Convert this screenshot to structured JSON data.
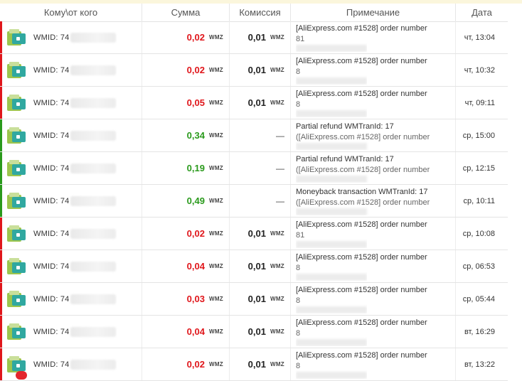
{
  "header": {
    "col_counterparty": "Кому\\от кого",
    "col_amount": "Сумма",
    "col_fee": "Комиссия",
    "col_note": "Примечание",
    "col_date": "Дата"
  },
  "colors": {
    "negative": "#e0161b",
    "positive": "#2a9a1c"
  },
  "rows": [
    {
      "wmid": "WMID: 74",
      "amount": "0,02",
      "type": "out",
      "currency": "WMZ",
      "fee": "0,01",
      "fee_currency": "WMZ",
      "note_line1": "[AliExpress.com #1528] order number",
      "note_line2": "81",
      "date": "чт, 13:04"
    },
    {
      "wmid": "WMID: 74",
      "amount": "0,02",
      "type": "out",
      "currency": "WMZ",
      "fee": "0,01",
      "fee_currency": "WMZ",
      "note_line1": "[AliExpress.com #1528] order number",
      "note_line2": "8",
      "date": "чт, 10:32"
    },
    {
      "wmid": "WMID: 74",
      "amount": "0,05",
      "type": "out",
      "currency": "WMZ",
      "fee": "0,01",
      "fee_currency": "WMZ",
      "note_line1": "[AliExpress.com #1528] order number",
      "note_line2": "8",
      "date": "чт, 09:11"
    },
    {
      "wmid": "WMID: 74",
      "amount": "0,34",
      "type": "in",
      "currency": "WMZ",
      "fee": "—",
      "fee_currency": "",
      "note_line1": "Partial refund WMTranId: 17",
      "note_line2": "([AliExpress.com #1528] order number",
      "date": "ср, 15:00"
    },
    {
      "wmid": "WMID: 74",
      "amount": "0,19",
      "type": "in",
      "currency": "WMZ",
      "fee": "—",
      "fee_currency": "",
      "note_line1": "Partial refund WMTranId: 17",
      "note_line2": "([AliExpress.com #1528] order number",
      "date": "ср, 12:15"
    },
    {
      "wmid": "WMID: 74",
      "amount": "0,49",
      "type": "in",
      "currency": "WMZ",
      "fee": "—",
      "fee_currency": "",
      "note_line1": "Moneyback transaction WMTranId: 17",
      "note_line2": "([AliExpress.com #1528] order number",
      "date": "ср, 10:11"
    },
    {
      "wmid": "WMID: 74",
      "amount": "0,02",
      "type": "out",
      "currency": "WMZ",
      "fee": "0,01",
      "fee_currency": "WMZ",
      "note_line1": "[AliExpress.com #1528] order number",
      "note_line2": "81",
      "date": "ср, 10:08"
    },
    {
      "wmid": "WMID: 74",
      "amount": "0,04",
      "type": "out",
      "currency": "WMZ",
      "fee": "0,01",
      "fee_currency": "WMZ",
      "note_line1": "[AliExpress.com #1528] order number",
      "note_line2": "8",
      "date": "ср, 06:53"
    },
    {
      "wmid": "WMID: 74",
      "amount": "0,03",
      "type": "out",
      "currency": "WMZ",
      "fee": "0,01",
      "fee_currency": "WMZ",
      "note_line1": "[AliExpress.com #1528] order number",
      "note_line2": "8",
      "date": "ср, 05:44"
    },
    {
      "wmid": "WMID: 74",
      "amount": "0,04",
      "type": "out",
      "currency": "WMZ",
      "fee": "0,01",
      "fee_currency": "WMZ",
      "note_line1": "[AliExpress.com #1528] order number",
      "note_line2": "8",
      "date": "вт, 16:29"
    },
    {
      "wmid": "WMID: 74",
      "amount": "0,02",
      "type": "out",
      "currency": "WMZ",
      "fee": "0,01",
      "fee_currency": "WMZ",
      "note_line1": "[AliExpress.com #1528] order number",
      "note_line2": "8",
      "date": "вт, 13:22"
    }
  ]
}
